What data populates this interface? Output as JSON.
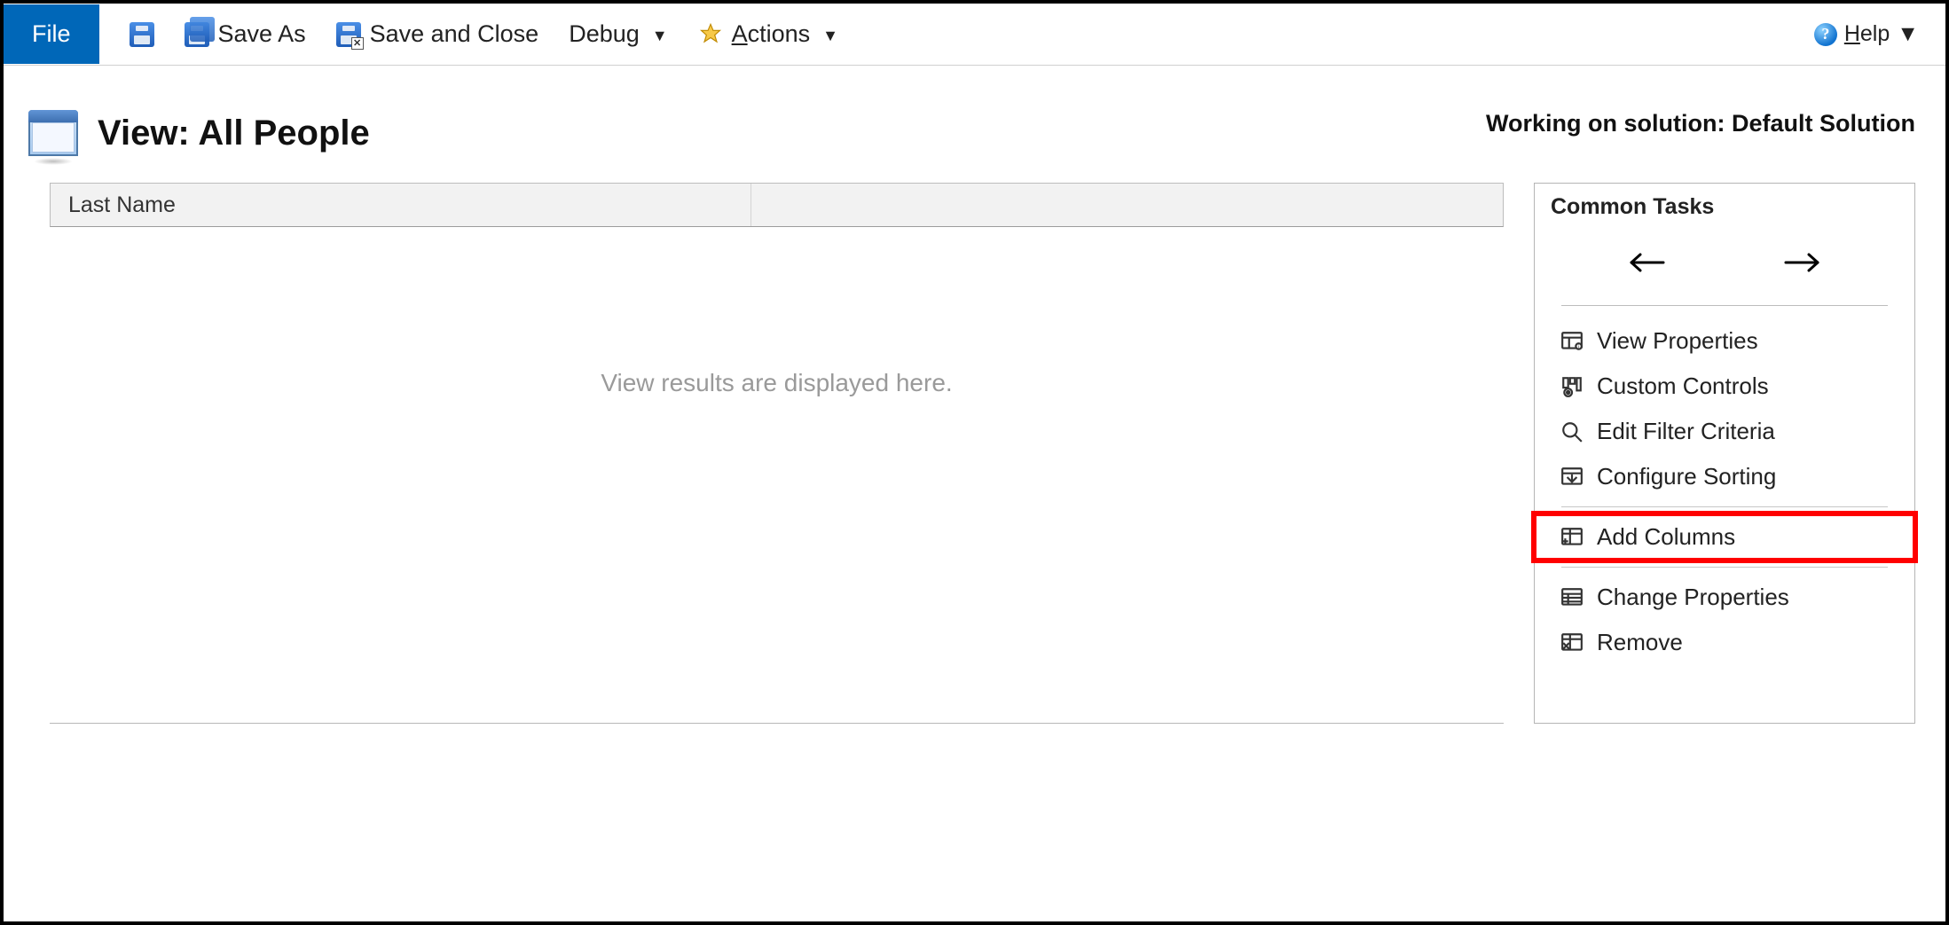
{
  "toolbar": {
    "file_label": "File",
    "save_as_label": "Save As",
    "save_close_label": "Save and Close",
    "debug_label": "Debug",
    "actions_label": "Actions",
    "help_label": "Help"
  },
  "header": {
    "title_prefix": "View:",
    "title_name": "All People",
    "solution_prefix": "Working on solution:",
    "solution_name": "Default Solution"
  },
  "grid": {
    "columns": [
      "Last Name"
    ],
    "placeholder": "View results are displayed here."
  },
  "tasks": {
    "panel_title": "Common Tasks",
    "items": {
      "view_properties": "View Properties",
      "custom_controls": "Custom Controls",
      "edit_filter": "Edit Filter Criteria",
      "configure_sorting": "Configure Sorting",
      "add_columns": "Add Columns",
      "change_properties": "Change Properties",
      "remove": "Remove"
    },
    "highlighted": "add_columns"
  }
}
